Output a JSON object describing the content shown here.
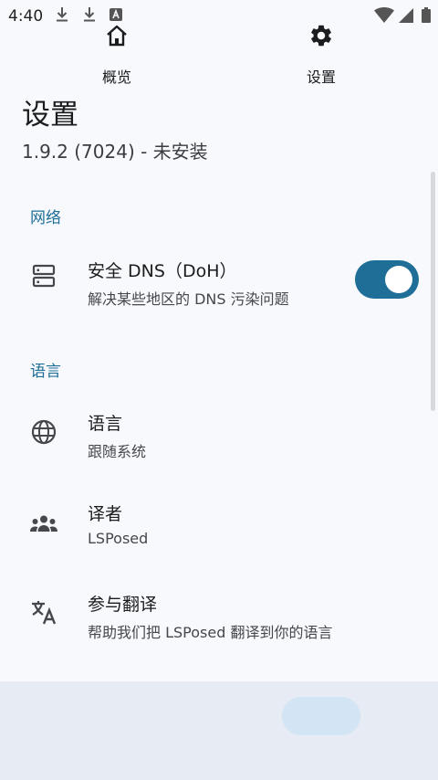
{
  "status_bar": {
    "time": "4:40",
    "icons": [
      "download-icon",
      "download-icon",
      "text-notification-icon",
      "wifi-icon",
      "cell-signal-icon",
      "battery-icon"
    ]
  },
  "header": {
    "title": "设置",
    "subtitle": "1.9.2 (7024) - 未安装"
  },
  "sections": {
    "network": {
      "header": "网络",
      "dns": {
        "title": "安全 DNS（DoH）",
        "summary": "解决某些地区的 DNS 污染问题",
        "enabled": true,
        "icon": "server-icon"
      }
    },
    "language": {
      "header": "语言",
      "items": [
        {
          "title": "语言",
          "summary": "跟随系统",
          "icon": "globe-icon"
        },
        {
          "title": "译者",
          "summary": "LSPosed",
          "icon": "group-icon"
        },
        {
          "title": "参与翻译",
          "summary": "帮助我们把 LSPosed 翻译到你的语言",
          "icon": "translate-icon"
        }
      ]
    }
  },
  "bottom_nav": {
    "items": [
      {
        "label": "概览",
        "icon": "home-icon",
        "selected": false
      },
      {
        "label": "设置",
        "icon": "gear-icon",
        "selected": true
      }
    ]
  },
  "colors": {
    "accent": "#1f6e98",
    "background": "#f8f9fc",
    "nav_background": "#e7ebf3",
    "nav_selected_pill": "#d3e4f4"
  }
}
